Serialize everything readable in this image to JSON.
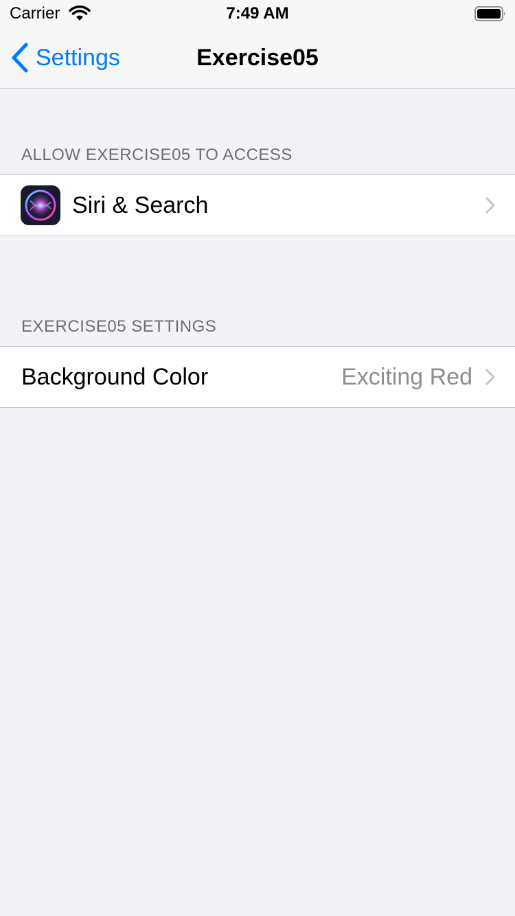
{
  "status_bar": {
    "carrier": "Carrier",
    "time": "7:49 AM",
    "wifi_icon": "wifi-icon",
    "battery_icon": "battery-icon"
  },
  "nav": {
    "back_label": "Settings",
    "back_icon": "chevron-left-icon",
    "title": "Exercise05"
  },
  "sections": [
    {
      "header": "ALLOW EXERCISE05 TO ACCESS",
      "rows": [
        {
          "icon": "siri-icon",
          "label": "Siri & Search",
          "chevron_icon": "chevron-right-icon"
        }
      ]
    },
    {
      "header": "EXERCISE05 SETTINGS",
      "rows": [
        {
          "label": "Background Color",
          "value": "Exciting Red",
          "chevron_icon": "chevron-right-icon"
        }
      ]
    }
  ],
  "colors": {
    "accent": "#007aff",
    "background": "#f2f2f7",
    "cell": "#ffffff",
    "separator": "#c8c7cc",
    "secondary_text": "#8e8e93",
    "header_text": "#6d6d72"
  }
}
